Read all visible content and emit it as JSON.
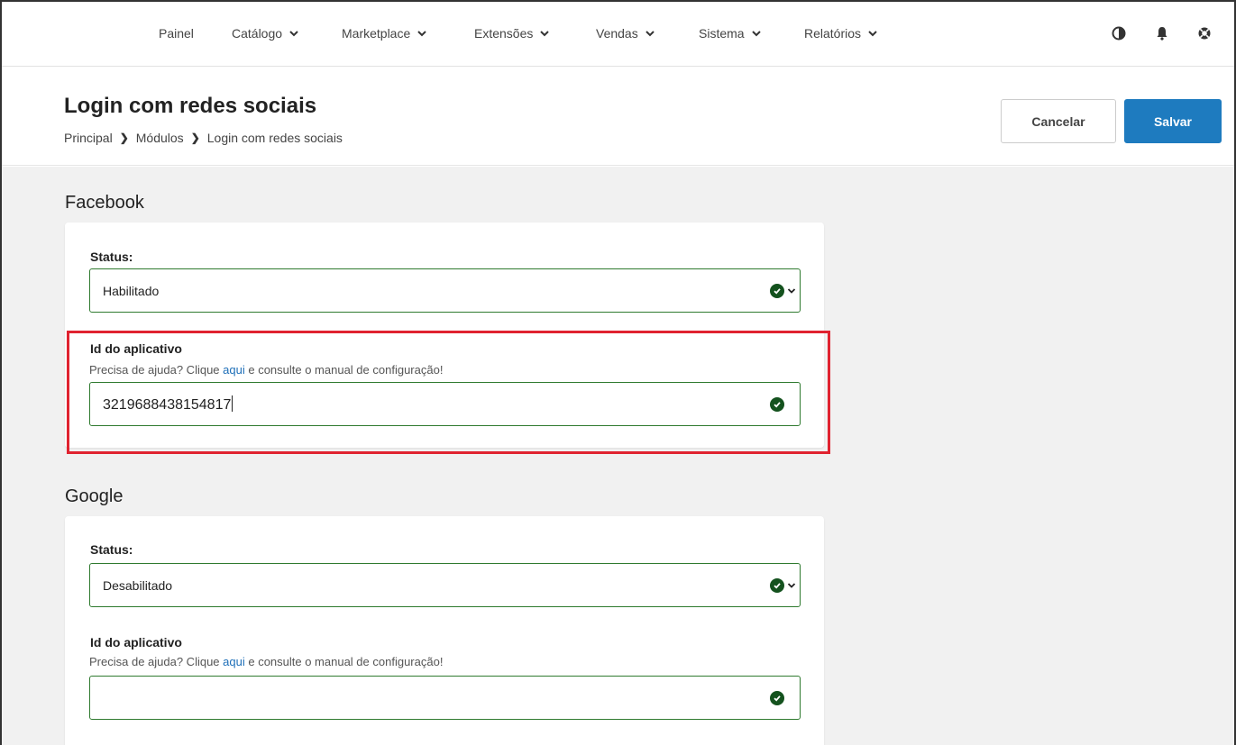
{
  "nav": {
    "items": [
      {
        "label": "Painel",
        "dropdown": false
      },
      {
        "label": "Catálogo",
        "dropdown": true
      },
      {
        "label": "Marketplace",
        "dropdown": true
      },
      {
        "label": "Extensões",
        "dropdown": true
      },
      {
        "label": "Vendas",
        "dropdown": true
      },
      {
        "label": "Sistema",
        "dropdown": true
      },
      {
        "label": "Relatórios",
        "dropdown": true
      }
    ],
    "icons": [
      "contrast-icon",
      "bell-icon",
      "help-lifebuoy-icon"
    ]
  },
  "header": {
    "title": "Login com redes sociais",
    "breadcrumb": [
      "Principal",
      "Módulos",
      "Login com redes sociais"
    ],
    "cancel_label": "Cancelar",
    "save_label": "Salvar"
  },
  "sections": [
    {
      "title": "Facebook",
      "status_label": "Status:",
      "status_value": "Habilitado",
      "app_id_label": "Id do aplicativo",
      "help_before": "Precisa de ajuda? Clique ",
      "help_link": "aqui",
      "help_after": " e consulte o manual de configuração!",
      "app_id_value": "3219688438154817"
    },
    {
      "title": "Google",
      "status_label": "Status:",
      "status_value": "Desabilitado",
      "app_id_label": "Id do aplicativo",
      "help_before": "Precisa de ajuda? Clique ",
      "help_link": "aqui",
      "help_after": " e consulte o manual de configuração!",
      "app_id_value": ""
    }
  ],
  "colors": {
    "primary": "#1e7bbf",
    "valid_border": "#2f7a2f",
    "valid_icon": "#14521e",
    "highlight": "#e02330",
    "background": "#f1f1f1"
  }
}
